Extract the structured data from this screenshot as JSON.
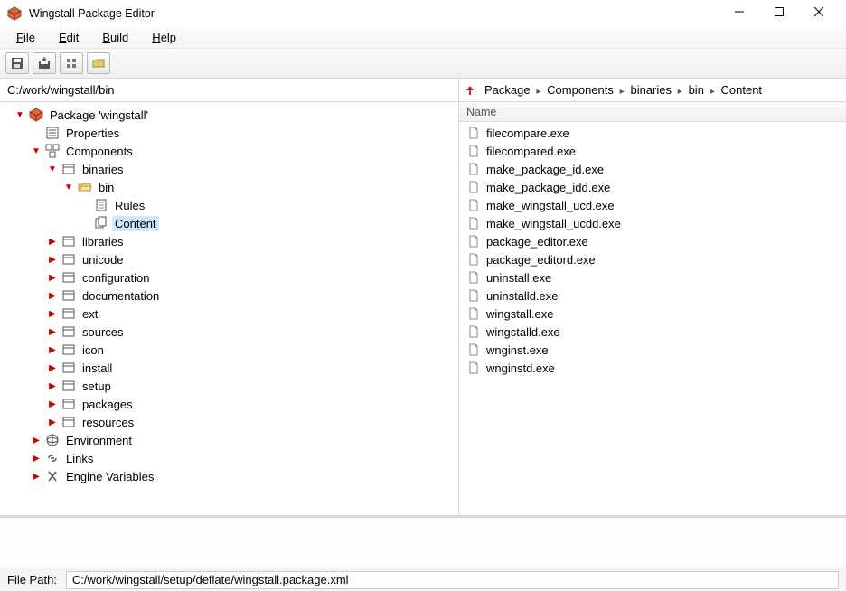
{
  "window": {
    "title": "Wingstall Package Editor"
  },
  "menu": {
    "file": "File",
    "edit": "Edit",
    "build": "Build",
    "help": "Help"
  },
  "toolbar_icons": [
    "save-icon",
    "save-to-icon",
    "build-icon",
    "open-icon"
  ],
  "left_path": "C:/work/wingstall/bin",
  "breadcrumb": {
    "items": [
      "Package",
      "Components",
      "binaries",
      "bin",
      "Content"
    ]
  },
  "right_header": "Name",
  "tree": [
    {
      "depth": 0,
      "arrow": "down",
      "icon": "package-icon",
      "label": "Package 'wingstall'"
    },
    {
      "depth": 1,
      "arrow": "none",
      "icon": "props-icon",
      "label": "Properties"
    },
    {
      "depth": 1,
      "arrow": "down",
      "icon": "component-icon",
      "label": "Components"
    },
    {
      "depth": 2,
      "arrow": "down",
      "icon": "dir-icon",
      "label": "binaries"
    },
    {
      "depth": 3,
      "arrow": "down",
      "icon": "folder-open-icon",
      "label": "bin"
    },
    {
      "depth": 4,
      "arrow": "none",
      "icon": "rules-icon",
      "label": "Rules"
    },
    {
      "depth": 4,
      "arrow": "none",
      "icon": "content-icon",
      "label": "Content",
      "selected": true
    },
    {
      "depth": 2,
      "arrow": "right",
      "icon": "dir-icon",
      "label": "libraries"
    },
    {
      "depth": 2,
      "arrow": "right",
      "icon": "dir-icon",
      "label": "unicode"
    },
    {
      "depth": 2,
      "arrow": "right",
      "icon": "dir-icon",
      "label": "configuration"
    },
    {
      "depth": 2,
      "arrow": "right",
      "icon": "dir-icon",
      "label": "documentation"
    },
    {
      "depth": 2,
      "arrow": "right",
      "icon": "dir-icon",
      "label": "ext"
    },
    {
      "depth": 2,
      "arrow": "right",
      "icon": "dir-icon",
      "label": "sources"
    },
    {
      "depth": 2,
      "arrow": "right",
      "icon": "dir-icon",
      "label": "icon"
    },
    {
      "depth": 2,
      "arrow": "right",
      "icon": "dir-icon",
      "label": "install"
    },
    {
      "depth": 2,
      "arrow": "right",
      "icon": "dir-icon",
      "label": "setup"
    },
    {
      "depth": 2,
      "arrow": "right",
      "icon": "dir-icon",
      "label": "packages"
    },
    {
      "depth": 2,
      "arrow": "right",
      "icon": "dir-icon",
      "label": "resources"
    },
    {
      "depth": 1,
      "arrow": "right",
      "icon": "env-icon",
      "label": "Environment"
    },
    {
      "depth": 1,
      "arrow": "right",
      "icon": "links-icon",
      "label": "Links"
    },
    {
      "depth": 1,
      "arrow": "right",
      "icon": "vars-icon",
      "label": "Engine Variables"
    }
  ],
  "files": [
    "filecompare.exe",
    "filecompared.exe",
    "make_package_id.exe",
    "make_package_idd.exe",
    "make_wingstall_ucd.exe",
    "make_wingstall_ucdd.exe",
    "package_editor.exe",
    "package_editord.exe",
    "uninstall.exe",
    "uninstalld.exe",
    "wingstall.exe",
    "wingstalld.exe",
    "wnginst.exe",
    "wnginstd.exe"
  ],
  "status": {
    "label": "File Path:",
    "value": "C:/work/wingstall/setup/deflate/wingstall.package.xml"
  }
}
